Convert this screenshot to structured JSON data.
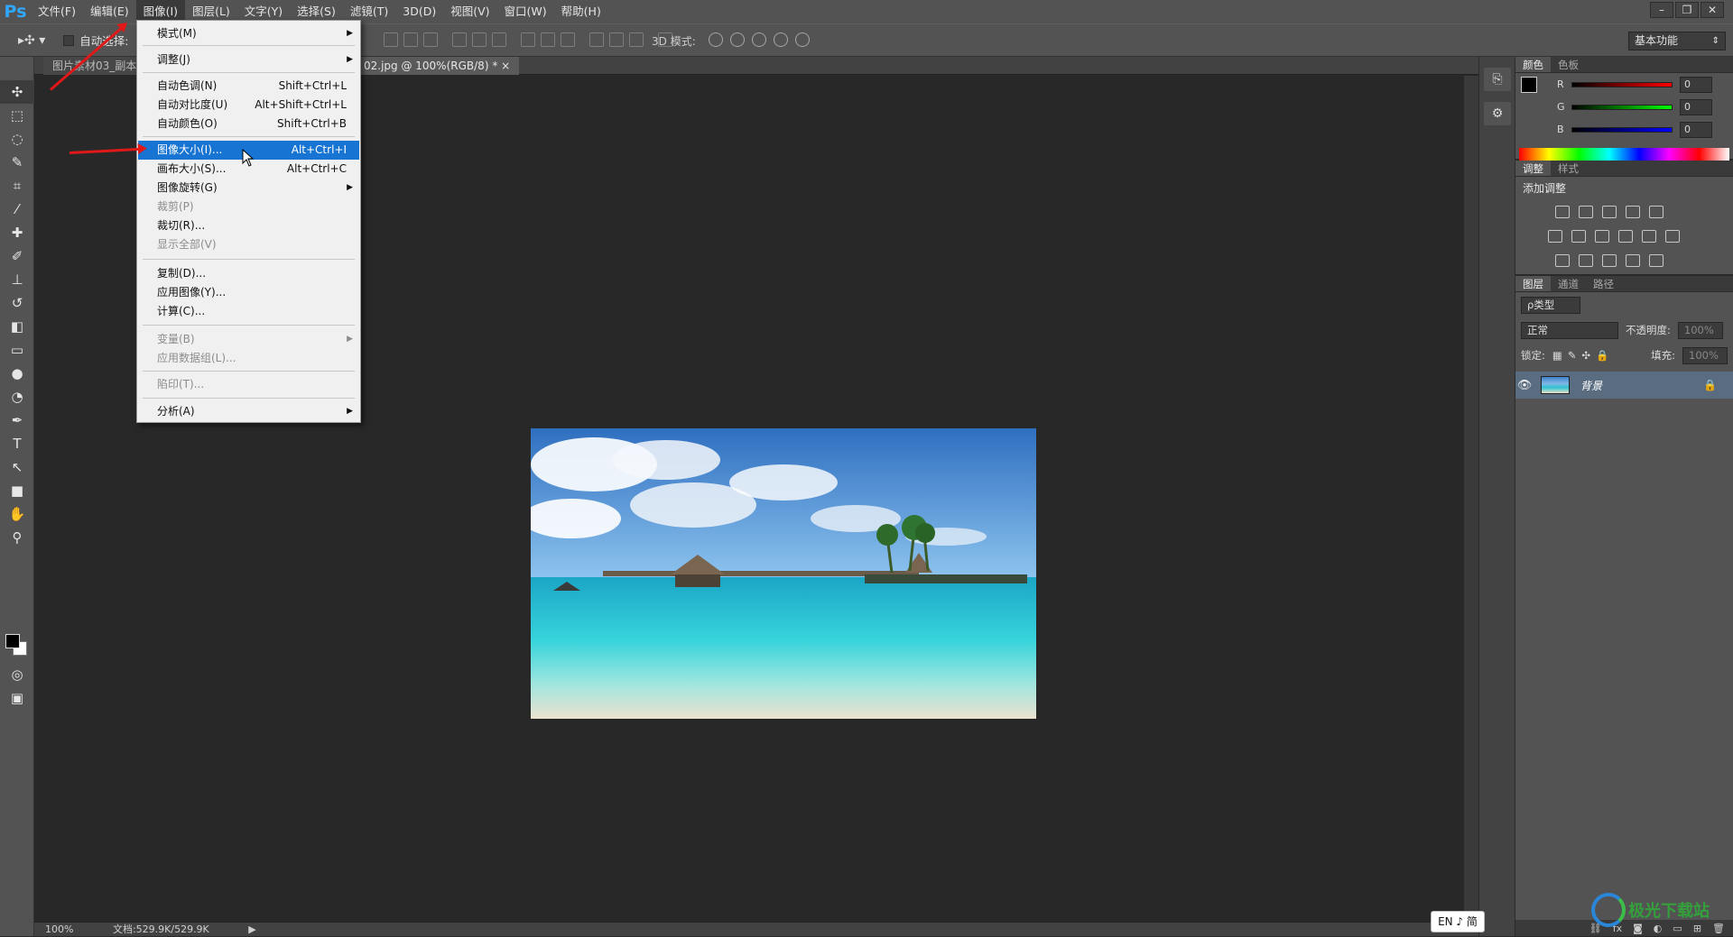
{
  "menubar": {
    "logo": "Ps",
    "items": [
      "文件(F)",
      "编辑(E)",
      "图像(I)",
      "图层(L)",
      "文字(Y)",
      "选择(S)",
      "滤镜(T)",
      "3D(D)",
      "视图(V)",
      "窗口(W)",
      "帮助(H)"
    ],
    "active_index": 2
  },
  "options_bar": {
    "auto_select_label": "自动选择:",
    "threed_mode_label": "3D 模式:",
    "workspace_value": "基本功能"
  },
  "doc_tabs": {
    "tab1": "图片素材03_副本...",
    "tab2": "02.jpg @ 100%(RGB/8) *"
  },
  "image_menu": {
    "items": [
      {
        "label": "模式(M)",
        "shortcut": "",
        "submenu": true,
        "disabled": false
      },
      {
        "label": "调整(J)",
        "shortcut": "",
        "submenu": true,
        "disabled": false
      },
      {
        "label": "自动色调(N)",
        "shortcut": "Shift+Ctrl+L",
        "submenu": false,
        "disabled": false
      },
      {
        "label": "自动对比度(U)",
        "shortcut": "Alt+Shift+Ctrl+L",
        "submenu": false,
        "disabled": false
      },
      {
        "label": "自动颜色(O)",
        "shortcut": "Shift+Ctrl+B",
        "submenu": false,
        "disabled": false
      },
      {
        "label": "图像大小(I)...",
        "shortcut": "Alt+Ctrl+I",
        "submenu": false,
        "disabled": false,
        "highlighted": true
      },
      {
        "label": "画布大小(S)...",
        "shortcut": "Alt+Ctrl+C",
        "submenu": false,
        "disabled": false
      },
      {
        "label": "图像旋转(G)",
        "shortcut": "",
        "submenu": true,
        "disabled": false
      },
      {
        "label": "裁剪(P)",
        "shortcut": "",
        "submenu": false,
        "disabled": true
      },
      {
        "label": "裁切(R)...",
        "shortcut": "",
        "submenu": false,
        "disabled": false
      },
      {
        "label": "显示全部(V)",
        "shortcut": "",
        "submenu": false,
        "disabled": true
      },
      {
        "label": "复制(D)...",
        "shortcut": "",
        "submenu": false,
        "disabled": false
      },
      {
        "label": "应用图像(Y)...",
        "shortcut": "",
        "submenu": false,
        "disabled": false
      },
      {
        "label": "计算(C)...",
        "shortcut": "",
        "submenu": false,
        "disabled": false
      },
      {
        "label": "变量(B)",
        "shortcut": "",
        "submenu": true,
        "disabled": true
      },
      {
        "label": "应用数据组(L)...",
        "shortcut": "",
        "submenu": false,
        "disabled": true
      },
      {
        "label": "陷印(T)...",
        "shortcut": "",
        "submenu": false,
        "disabled": true
      },
      {
        "label": "分析(A)",
        "shortcut": "",
        "submenu": true,
        "disabled": false
      }
    ]
  },
  "color_panel": {
    "tabs": [
      "颜色",
      "色板"
    ],
    "channels": [
      {
        "label": "R",
        "value": "0",
        "color": "#e02020"
      },
      {
        "label": "G",
        "value": "0",
        "color": "#20c020"
      },
      {
        "label": "B",
        "value": "0",
        "color": "#2030e0"
      }
    ]
  },
  "adjust_panel": {
    "tabs": [
      "调整",
      "样式"
    ],
    "heading": "添加调整"
  },
  "layers_panel": {
    "tabs": [
      "图层",
      "通道",
      "路径"
    ],
    "filter_kind": "ρ类型",
    "blend_mode": "正常",
    "opacity_label": "不透明度:",
    "opacity_value": "100%",
    "lock_label": "锁定:",
    "fill_label": "填充:",
    "fill_value": "100%",
    "layer_name": "背景"
  },
  "status_bar": {
    "zoom": "100%",
    "doc_info": "文档:529.9K/529.9K"
  },
  "ime": "EN ♪ 简",
  "watermark": "极光下载站"
}
